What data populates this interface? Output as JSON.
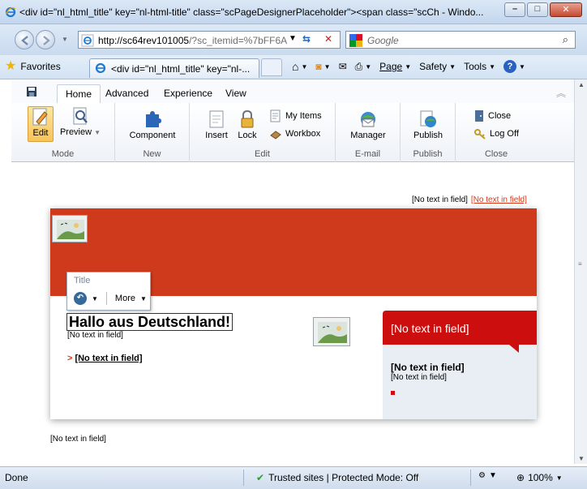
{
  "window": {
    "title": "<div id=\"nl_html_title\" key=\"nl-html-title\" class=\"scPageDesignerPlaceholder\"><span class=\"scCh - Windo...",
    "minimize": "–",
    "maximize": "□",
    "close": "✕"
  },
  "address": {
    "url_host": "http://sc64rev101005",
    "url_rest": "/?sc_itemid=%7bFF6A",
    "search_placeholder": "Google"
  },
  "favorites": {
    "label": "Favorites",
    "tab_title": "<div id=\"nl_html_title\" key=\"nl-..."
  },
  "commandbar": {
    "page": "Page",
    "safety": "Safety",
    "tools": "Tools",
    "help": "?"
  },
  "ribbon": {
    "tabs": [
      "Home",
      "Advanced",
      "Experience",
      "View"
    ],
    "groups": {
      "mode": {
        "label": "Mode",
        "edit": "Edit",
        "preview": "Preview"
      },
      "new": {
        "label": "New",
        "component": "Component"
      },
      "edit": {
        "label": "Edit",
        "insert": "Insert",
        "lock": "Lock",
        "my_items": "My Items",
        "workbox": "Workbox"
      },
      "email": {
        "label": "E-mail",
        "manager": "Manager"
      },
      "publish": {
        "label": "Publish",
        "publish": "Publish"
      },
      "close": {
        "label": "Close",
        "close": "Close",
        "log_off": "Log Off"
      }
    }
  },
  "page": {
    "top_field_1": "[No text in field]",
    "top_field_2": "[No text in field]",
    "title_panel": {
      "label": "Title",
      "more": "More"
    },
    "heading": "Hallo aus Deutschland!",
    "sub_text": "[No text in field]",
    "sub_link": "[No text in field]",
    "sidebar": {
      "header": "[No text in field]",
      "bold": "[No text in field]",
      "normal": "[No text in field]"
    },
    "bottom_field": "[No text in field]"
  },
  "status": {
    "done": "Done",
    "security": "Trusted sites | Protected Mode: Off",
    "zoom": "100%"
  },
  "colors": {
    "banner": "#cf3a1d",
    "sidebar_header": "#cc0e0e",
    "link": "#d63a1a"
  }
}
